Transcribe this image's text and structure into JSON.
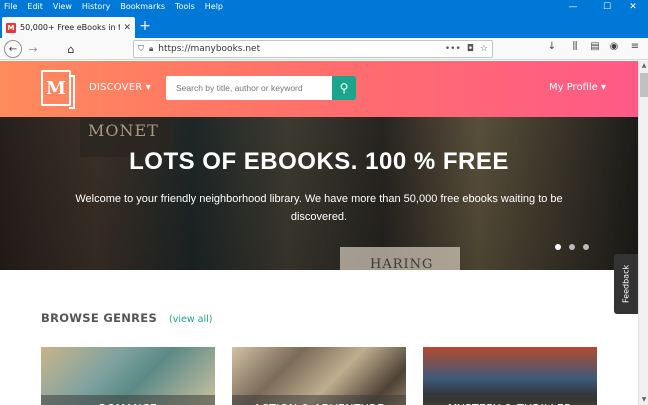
{
  "menu": [
    "File",
    "Edit",
    "View",
    "History",
    "Bookmarks",
    "Tools",
    "Help"
  ],
  "tab": {
    "title": "50,000+ Free eBooks in the Ge",
    "favicon_letter": "M"
  },
  "window_controls": {
    "minimize": "—",
    "maximize": "☐",
    "close": "✕"
  },
  "navbar": {
    "url": "https://manybooks.net"
  },
  "site": {
    "logo_letter": "M",
    "discover": "DISCOVER ▾",
    "search_placeholder": "Search by title, author or keyword",
    "profile": "My Profile ▾"
  },
  "hero": {
    "title": "LOTS OF EBOOKS. 100 % FREE",
    "subtitle": "Welcome to your friendly neighborhood library. We have more than 50,000 free ebooks waiting to be discovered.",
    "bg_text_1": "MONET",
    "bg_text_2": "HARING",
    "slides": 3,
    "active_slide": 1
  },
  "feedback": "Feedback",
  "genres": {
    "title": "BROWSE GENRES",
    "view_all": "(view all)",
    "cards": [
      "ROMANCE",
      "ACTION & ADVENTURE",
      "MYSTERY & THRILLER"
    ]
  },
  "colors": {
    "chrome_blue": "#0078d7",
    "accent": "#1aa68c"
  }
}
